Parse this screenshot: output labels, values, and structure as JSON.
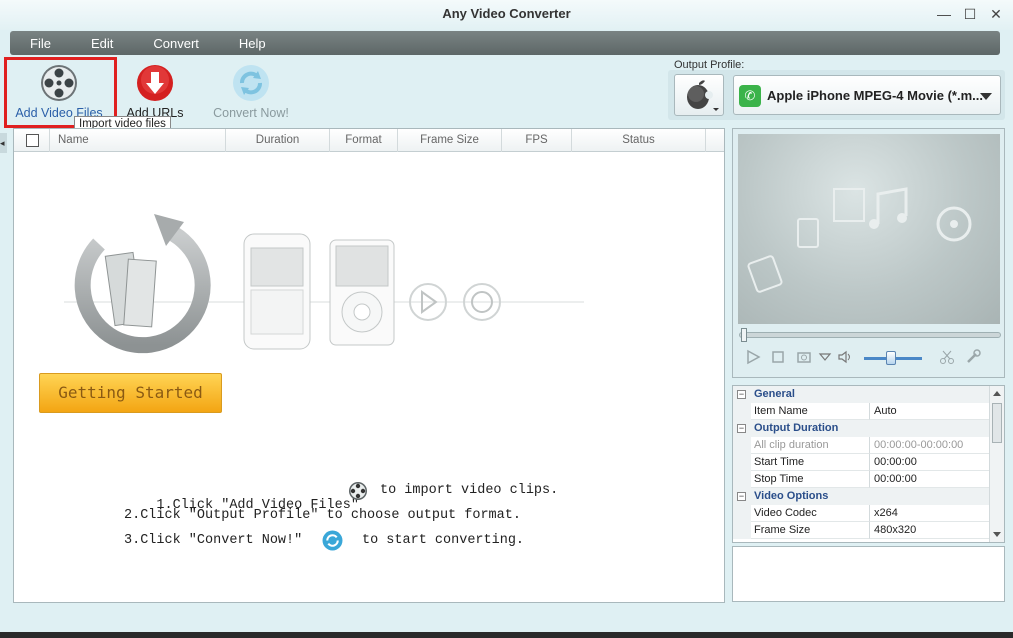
{
  "window": {
    "title": "Any Video Converter",
    "controls": [
      "—",
      "☐",
      "✕"
    ]
  },
  "menu": [
    "File",
    "Edit",
    "Convert",
    "Help"
  ],
  "toolbar": {
    "add_video": "Add Video Files",
    "add_urls": "Add URLs",
    "convert_now": "Convert Now!",
    "tooltip": "Import video files"
  },
  "output_profile": {
    "label": "Output Profile:",
    "device_icon": "apple-icon",
    "selected": "Apple iPhone MPEG-4 Movie (*.m..."
  },
  "file_list": {
    "columns": [
      "Name",
      "Duration",
      "Format",
      "Frame Size",
      "FPS",
      "Status"
    ]
  },
  "getting_started": "Getting Started",
  "instructions": {
    "step1_a": "1.Click \"Add Video Files\"",
    "step1_b": "to import video clips.",
    "step2": "2.Click \"Output Profile\" to choose output format.",
    "step3_a": "3.Click \"Convert Now!\"",
    "step3_b": "to start converting."
  },
  "properties": {
    "general": "General",
    "item_name_key": "Item Name",
    "item_name_val": "Auto",
    "output_duration": "Output Duration",
    "all_clip_key": "All clip duration",
    "all_clip_val": "00:00:00-00:00:00",
    "start_key": "Start Time",
    "start_val": "00:00:00",
    "stop_key": "Stop Time",
    "stop_val": "00:00:00",
    "video_options": "Video Options",
    "codec_key": "Video Codec",
    "codec_val": "x264",
    "frame_key": "Frame Size",
    "frame_val": "480x320"
  },
  "colors": {
    "accent_highlight": "#e02020",
    "getting_started_bg": "#f3a513",
    "menubar": "#5d6767",
    "group_text": "#2a4e8a"
  }
}
